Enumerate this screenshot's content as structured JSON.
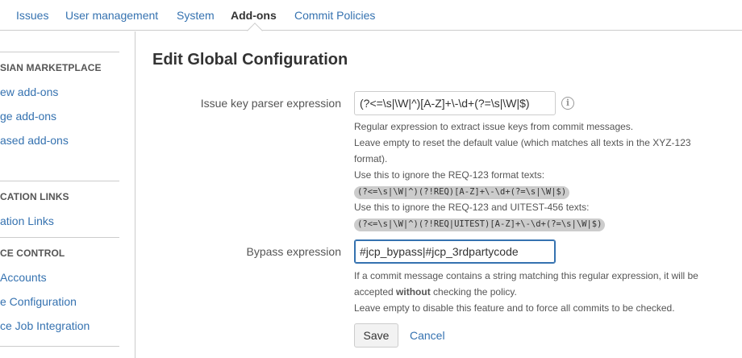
{
  "nav": {
    "tabs": [
      {
        "label": "Issues"
      },
      {
        "label": "User management"
      },
      {
        "label": "System"
      },
      {
        "label": "Add-ons",
        "active": true
      },
      {
        "label": "Commit Policies"
      }
    ]
  },
  "sidebar": {
    "sections": [
      {
        "heading": "SIAN MARKETPLACE",
        "items": [
          "ew add-ons",
          "ge add-ons",
          "ased add-ons"
        ]
      },
      {
        "heading": "CATION LINKS",
        "items": [
          "ation Links"
        ]
      },
      {
        "heading": "CE CONTROL",
        "items": [
          "Accounts",
          "e Configuration",
          "ce Job Integration"
        ]
      }
    ]
  },
  "page": {
    "title": "Edit Global Configuration",
    "issue_key": {
      "label": "Issue key parser expression",
      "value": "(?<=\\s|\\W|^)[A-Z]+\\-\\d+(?=\\s|\\W|$)",
      "desc_line1": "Regular expression to extract issue keys from commit messages.",
      "desc_line2": "Leave empty to reset the default value (which matches all texts in the XYZ-123",
      "desc_line3": "format).",
      "desc_line4": "Use this to ignore the REQ-123 format texts:",
      "code1": "(?<=\\s|\\W|^)(?!REQ)[A-Z]+\\-\\d+(?=\\s|\\W|$)",
      "desc_line5": "Use this to ignore the REQ-123 and UITEST-456 texts:",
      "code2": "(?<=\\s|\\W|^)(?!REQ|UITEST)[A-Z]+\\-\\d+(?=\\s|\\W|$)"
    },
    "bypass": {
      "label": "Bypass expression",
      "value": "#jcp_bypass|#jcp_3rdpartycode",
      "desc_line1": "If a commit message contains a string matching this regular expression, it will be",
      "desc_line2_pre": "accepted ",
      "desc_line2_bold": "without",
      "desc_line2_post": " checking the policy.",
      "desc_line3": "Leave empty to disable this feature and to force all commits to be checked."
    },
    "save_label": "Save",
    "cancel_label": "Cancel"
  },
  "colors": {
    "link": "#3572b0",
    "text": "#333333",
    "border": "#cccccc",
    "focus": "#3572b0"
  },
  "icons": {
    "info": "info-icon"
  }
}
